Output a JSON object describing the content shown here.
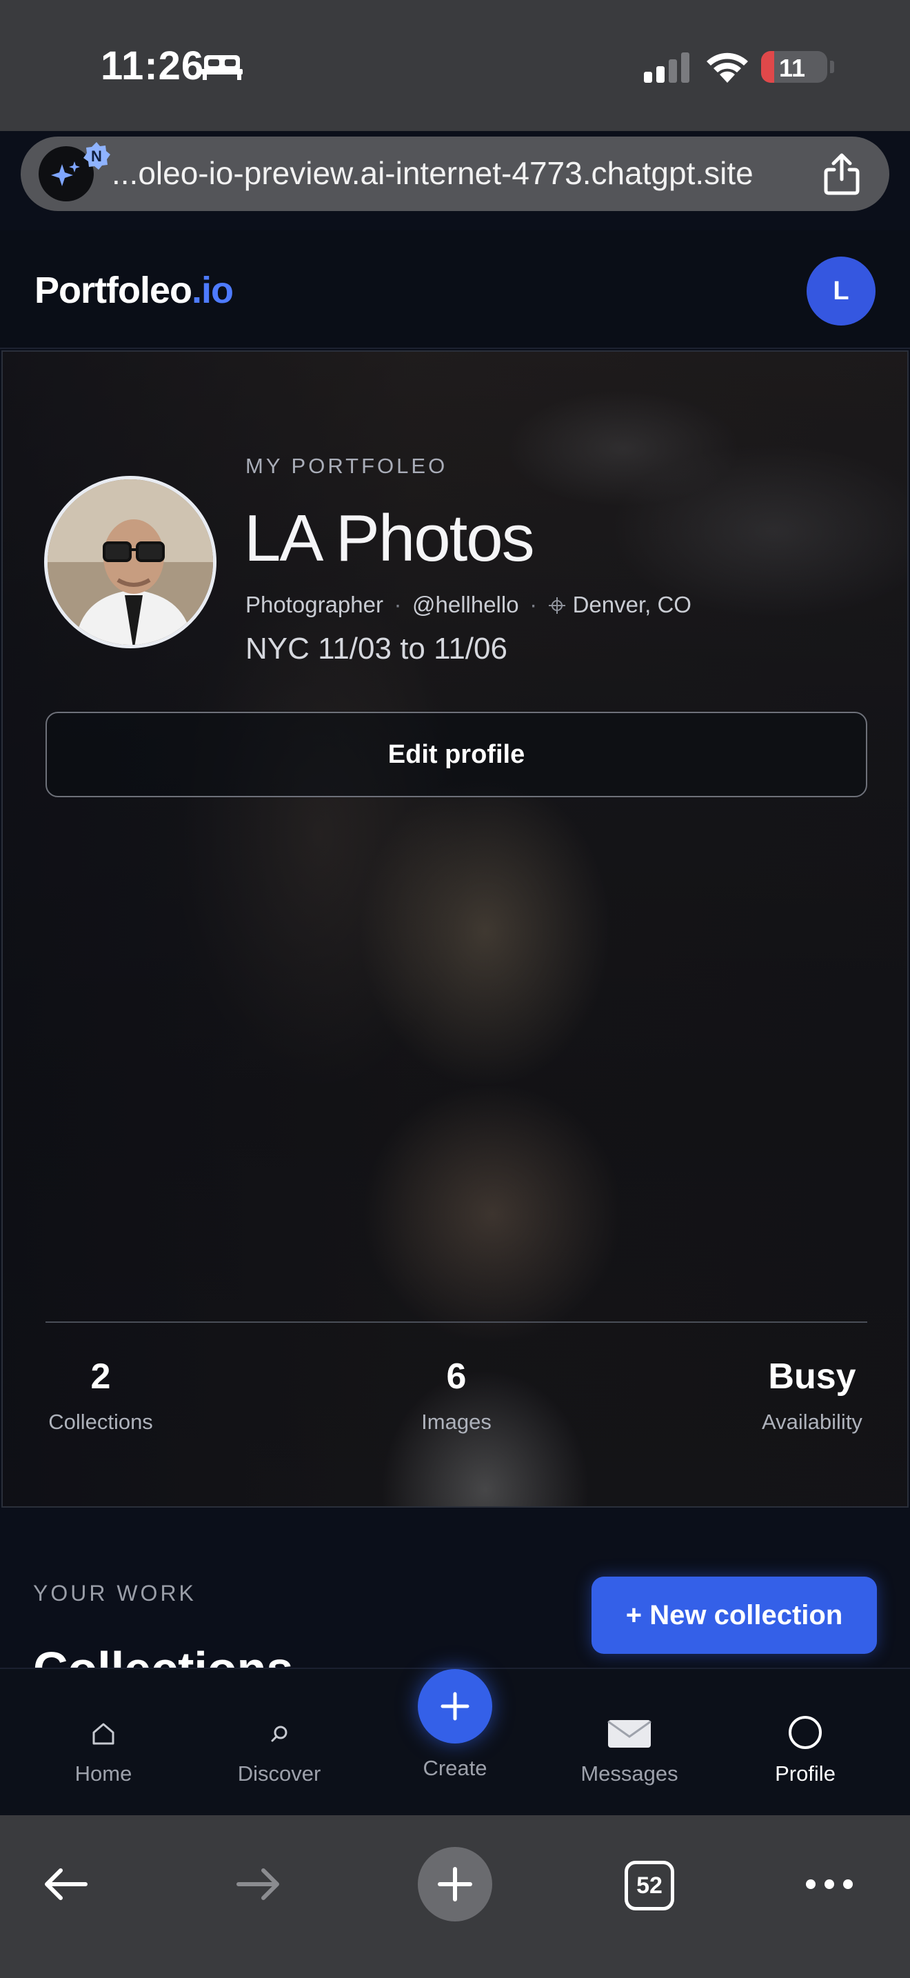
{
  "status_bar": {
    "time": "11:26",
    "battery_level": "11",
    "battery_fraction": 0.11,
    "icons": [
      "bed-icon",
      "cellular-signal-icon",
      "wifi-icon",
      "battery-icon"
    ]
  },
  "url_bar": {
    "url": "...oleo-io-preview.ai-internet-4773.chatgpt.site",
    "icons": [
      "ai-sparkle-icon",
      "share-icon"
    ]
  },
  "header": {
    "logo_main": "Portfoleo",
    "logo_accent": ".io",
    "avatar_initial": "L",
    "accent_color": "#4e7bff"
  },
  "profile": {
    "eyebrow": "MY PORTFOLEO",
    "title": "LA Photos",
    "role": "Photographer",
    "handle": "@hellhello",
    "location": "Denver, CO",
    "dates": "NYC 11/03 to 11/06",
    "edit_label": "Edit profile"
  },
  "stats": [
    {
      "value": "2",
      "label": "Collections"
    },
    {
      "value": "6",
      "label": "Images"
    },
    {
      "value": "Busy",
      "label": "Availability"
    }
  ],
  "work": {
    "eyebrow": "YOUR WORK",
    "heading": "Collections",
    "new_button": "+ New collection",
    "button_color": "#3460e8"
  },
  "bottom_nav": [
    {
      "label": "Home",
      "icon": "home-icon"
    },
    {
      "label": "Discover",
      "icon": "search-icon"
    },
    {
      "label": "Create",
      "icon": "plus-icon"
    },
    {
      "label": "Messages",
      "icon": "envelope-icon"
    },
    {
      "label": "Profile",
      "icon": "profile-circle-icon",
      "active": true
    }
  ],
  "browser_toolbar": {
    "tab_count": "52",
    "icons": [
      "back-arrow-icon",
      "forward-arrow-icon",
      "new-tab-plus-icon",
      "tabs-icon",
      "more-icon"
    ]
  }
}
